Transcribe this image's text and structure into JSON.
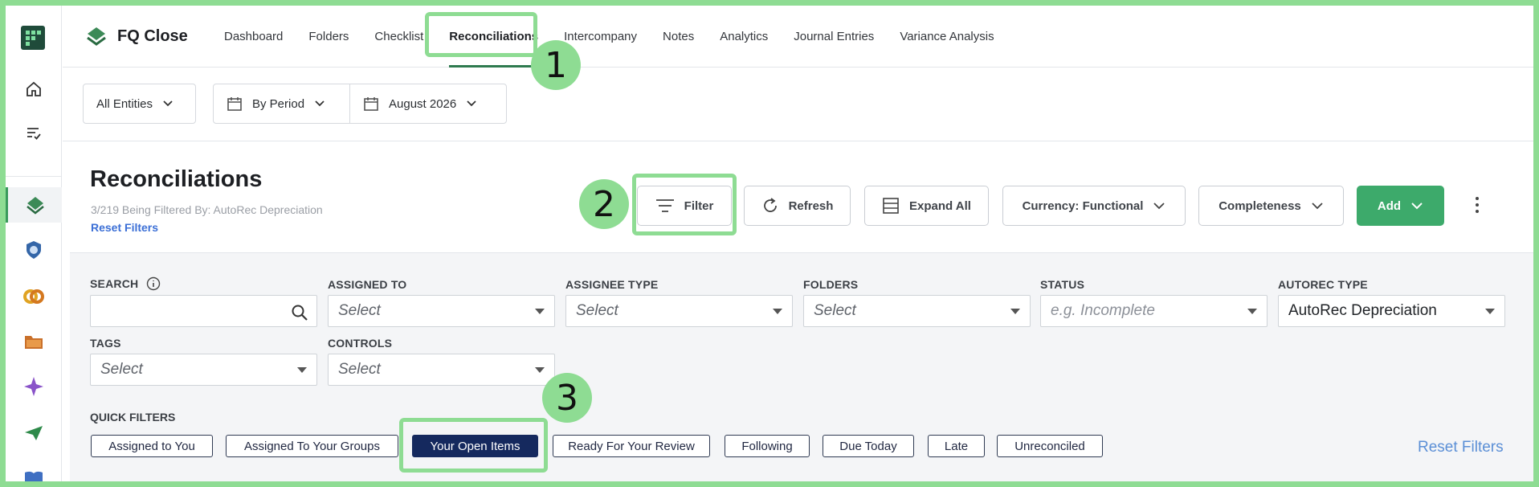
{
  "app": {
    "brand": "FQ Close"
  },
  "nav": {
    "tabs": [
      "Dashboard",
      "Folders",
      "Checklist",
      "Reconciliations",
      "Intercompany",
      "Notes",
      "Analytics",
      "Journal Entries",
      "Variance Analysis"
    ],
    "active": "Reconciliations"
  },
  "period_bar": {
    "entities": "All Entities",
    "period_mode": "By Period",
    "period": "August 2026"
  },
  "header": {
    "title": "Reconciliations",
    "filter_info": "3/219 Being Filtered By: AutoRec Depreciation",
    "reset_link": "Reset Filters",
    "filter_button": "Filter",
    "refresh_button": "Refresh",
    "expand_button": "Expand All",
    "currency_dropdown": "Currency: Functional",
    "completeness_dropdown": "Completeness",
    "add_button": "Add"
  },
  "filters": {
    "search": {
      "label": "SEARCH",
      "value": ""
    },
    "assigned_to": {
      "label": "ASSIGNED TO",
      "placeholder": "Select"
    },
    "assignee_type": {
      "label": "ASSIGNEE TYPE",
      "placeholder": "Select"
    },
    "folders": {
      "label": "FOLDERS",
      "placeholder": "Select"
    },
    "status": {
      "label": "STATUS",
      "placeholder": "e.g. Incomplete"
    },
    "autorec_type": {
      "label": "AUTOREC TYPE",
      "value": "AutoRec Depreciation"
    },
    "tags": {
      "label": "TAGS",
      "placeholder": "Select"
    },
    "controls": {
      "label": "CONTROLS",
      "placeholder": "Select"
    }
  },
  "quick_filters": {
    "label": "QUICK FILTERS",
    "chips": [
      "Assigned to You",
      "Assigned To Your Groups",
      "Your Open Items",
      "Ready For Your Review",
      "Following",
      "Due Today",
      "Late",
      "Unreconciled"
    ],
    "selected": "Your Open Items",
    "reset": "Reset Filters"
  },
  "annotations": [
    "1",
    "2",
    "3"
  ],
  "colors": {
    "accent_green": "#3daa6b",
    "highlight": "#8edc93",
    "selected_chip": "#15295e",
    "link": "#3b6fd6"
  }
}
